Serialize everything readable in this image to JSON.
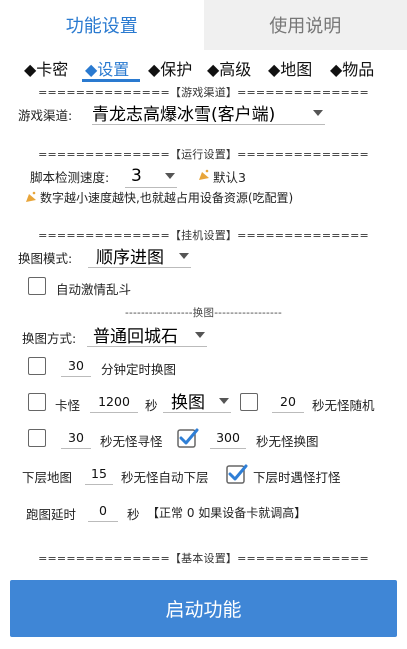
{
  "tabs": [
    {
      "label": "功能设置",
      "active": true
    },
    {
      "label": "使用说明",
      "active": false
    }
  ],
  "subtabs": [
    "◆卡密",
    "◆设置",
    "◆保护",
    "◆高级",
    "◆地图",
    "◆物品"
  ],
  "selected_subtab": "◆设置",
  "sections": {
    "game_channel": "==============【游戏渠道】==============",
    "run_settings": "==============【运行设置】==============",
    "hang_settings": "==============【挂机设置】==============",
    "switch_map": "-----------------换图-----------------",
    "basic_settings": "==============【基本设置】=============="
  },
  "game_channel": {
    "label": "游戏渠道:",
    "value": "青龙志高爆冰雪(客户端)"
  },
  "script_speed": {
    "label": "脚本检测速度:",
    "value": "3",
    "default_tip": "默认3"
  },
  "speed_tip": "数字越小速度越快,也就越占用设备资源(吃配置)",
  "map_mode": {
    "label": "换图模式:",
    "value": "顺序进图"
  },
  "auto_fight": {
    "label": "自动激情乱斗",
    "checked": false
  },
  "switch_method": {
    "label": "换图方式:",
    "value": "普通回城石"
  },
  "timed_switch": {
    "checked": false,
    "value": "30",
    "label": "分钟定时换图"
  },
  "stuck": {
    "checked": false,
    "label": "卡怪",
    "value": "1200",
    "unit": "秒",
    "action": "换图",
    "random_checked": false,
    "random_value": "20",
    "random_label": "秒无怪随机"
  },
  "seek": {
    "checked": false,
    "value": "30",
    "label": "秒无怪寻怪",
    "switch_checked": true,
    "switch_value": "300",
    "switch_label": "秒无怪换图"
  },
  "lower_map": {
    "label": "下层地图",
    "value": "15",
    "auto_label": "秒无怪自动下层",
    "fight_checked": true,
    "fight_label": "下层时遇怪打怪"
  },
  "run_delay": {
    "label": "跑图延时",
    "value": "0",
    "unit": "秒",
    "note": "【正常 0 如果设备卡就调高】"
  },
  "start_button": "启动功能",
  "colors": {
    "accent": "#2a7ad0",
    "button": "#3f86d6",
    "check": "#2f7fd6",
    "tip_icon": "#e8a53a"
  }
}
